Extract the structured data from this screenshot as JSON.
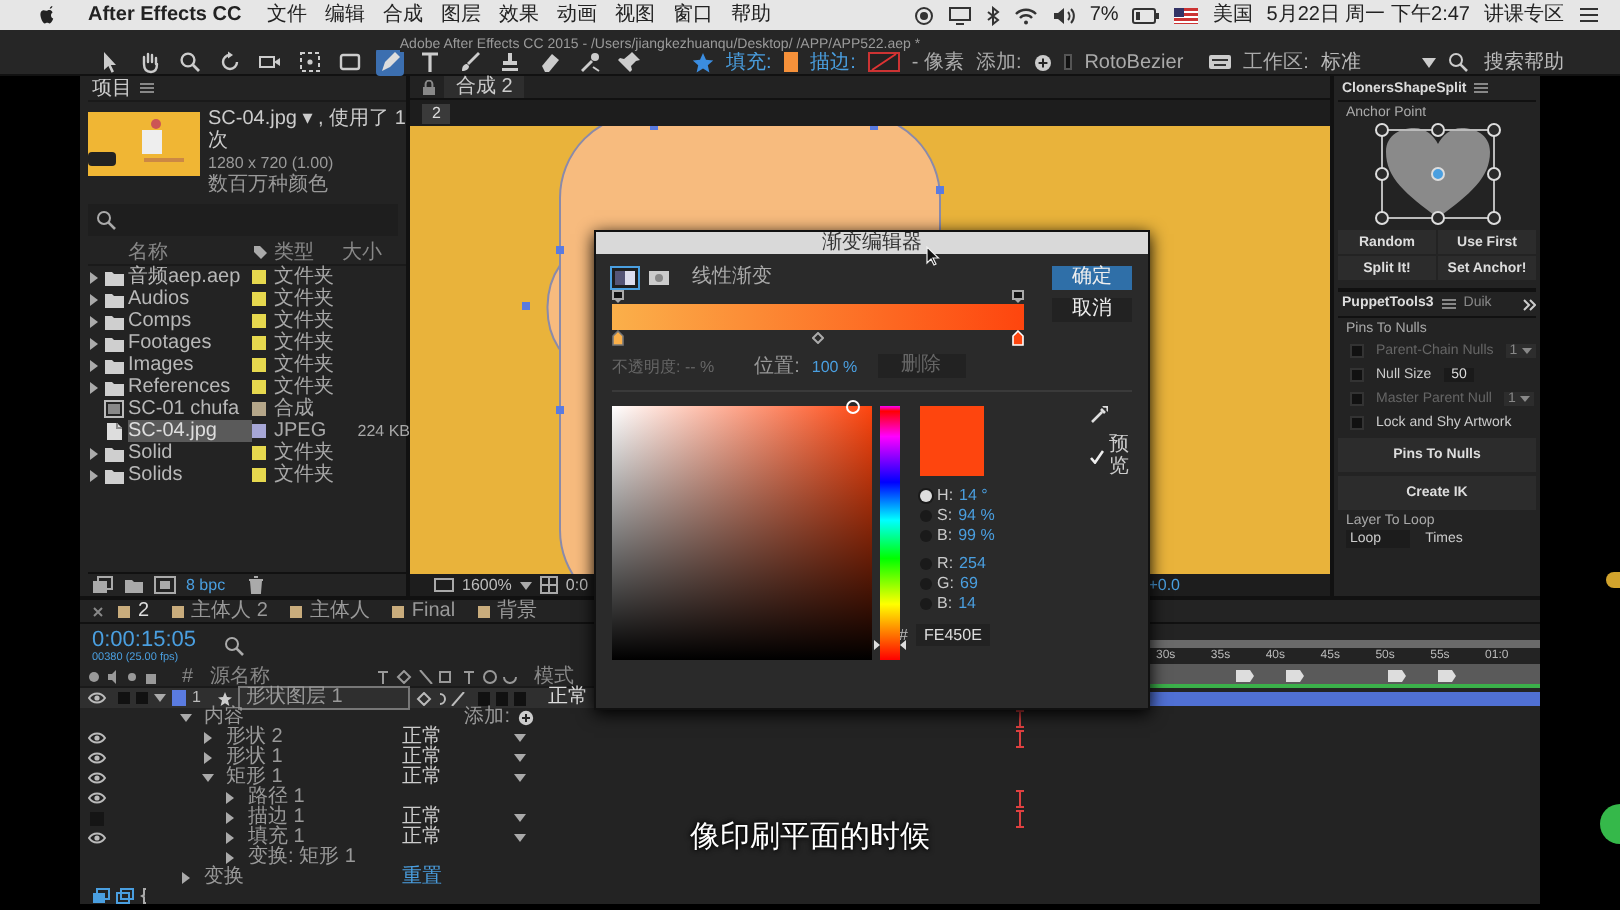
{
  "menubar": {
    "app": "After Effects CC",
    "menus": [
      "文件",
      "编辑",
      "合成",
      "图层",
      "效果",
      "动画",
      "视图",
      "窗口",
      "帮助"
    ],
    "battery": "7%",
    "input_source": "美国",
    "clock": "5月22日 周一 下午2:47",
    "user": "讲课专区"
  },
  "window": {
    "title": "Adobe After Effects CC 2015 - /Users/jiangkezhuanqu/Desktop/ /APP/APP522.aep *"
  },
  "toolbar": {
    "tools": [
      {
        "kind": "selection",
        "selected": false
      },
      {
        "kind": "hand",
        "selected": false
      },
      {
        "kind": "zoom",
        "selected": false
      },
      {
        "kind": "rotate",
        "selected": false
      },
      {
        "kind": "camera",
        "selected": false
      },
      {
        "kind": "pan",
        "selected": false
      },
      {
        "kind": "rectangle",
        "selected": false
      },
      {
        "kind": "pen",
        "selected": true
      },
      {
        "kind": "text",
        "selected": false
      },
      {
        "kind": "brush",
        "selected": false
      },
      {
        "kind": "stamp",
        "selected": false
      },
      {
        "kind": "eraser",
        "selected": false
      },
      {
        "kind": "roto",
        "selected": false
      },
      {
        "kind": "pin",
        "selected": false
      }
    ],
    "fill_label": "填充:",
    "stroke_label": "描边:",
    "stroke_width": "- 像素",
    "add_label": "添加:",
    "rotobezier": {
      "label": "RotoBezier",
      "checked": false
    },
    "workspace_label": "工作区:",
    "workspace": "标准",
    "search_placeholder": "搜索帮助"
  },
  "project": {
    "title": "项目",
    "file_name": "SC-04.jpg ▾ , 使用了 1 次",
    "dimensions": "1280 x 720 (1.00)",
    "color_depth": "数百万种颜色",
    "columns": [
      "名称",
      "类型",
      "大小"
    ],
    "rows": [
      {
        "name": "音频aep.aep",
        "kind": "folder",
        "expanded": false,
        "type": "文件夹",
        "color": "#e6d84e",
        "selected": false
      },
      {
        "name": "Audios",
        "kind": "folder",
        "expanded": false,
        "type": "文件夹",
        "color": "#e6d84e",
        "selected": false
      },
      {
        "name": "Comps",
        "kind": "folder",
        "expanded": false,
        "type": "文件夹",
        "color": "#e6d84e",
        "selected": false
      },
      {
        "name": "Footages",
        "kind": "folder",
        "expanded": false,
        "type": "文件夹",
        "color": "#e6d84e",
        "selected": false
      },
      {
        "name": "Images",
        "kind": "folder",
        "expanded": false,
        "type": "文件夹",
        "color": "#e6d84e",
        "selected": false
      },
      {
        "name": "References",
        "kind": "folder",
        "expanded": false,
        "type": "文件夹",
        "color": "#e6d84e",
        "selected": false
      },
      {
        "name": "SC-01 chufa",
        "kind": "comp",
        "type": "合成",
        "color": "#b5a689",
        "selected": false
      },
      {
        "name": "SC-04.jpg",
        "kind": "image",
        "type": "JPEG",
        "size": "224 KB",
        "color": "#a6a6d6",
        "selected": true
      },
      {
        "name": "Solid",
        "kind": "folder",
        "expanded": false,
        "type": "文件夹",
        "color": "#e6d84e",
        "selected": false
      },
      {
        "name": "Solids",
        "kind": "folder",
        "expanded": false,
        "type": "文件夹",
        "color": "#e6d84e",
        "selected": false
      }
    ],
    "bpc": "8 bpc"
  },
  "viewer": {
    "tab": "合成 2",
    "breadcrumb": "2",
    "zoom": "1600%",
    "timecode": "0:0",
    "exposure": "+0.0"
  },
  "cloners": {
    "title": "ClonersShapeSplit",
    "anchor_label": "Anchor Point",
    "anchor_points": [
      {
        "selected": false
      },
      {
        "selected": false
      },
      {
        "selected": false
      },
      {
        "selected": false
      },
      {
        "selected": true
      },
      {
        "selected": false
      },
      {
        "selected": false
      },
      {
        "selected": false
      },
      {
        "selected": false
      }
    ],
    "buttons": [
      "Random",
      "Use First",
      "Split It!",
      "Set Anchor!"
    ]
  },
  "puppet": {
    "tabs": [
      {
        "label": "PuppetTools3",
        "selected": true
      },
      {
        "label": "Duik",
        "selected": false
      }
    ],
    "section": "Pins To Nulls",
    "options": [
      {
        "label": "Parent-Chain Nulls",
        "kind": "dropdown",
        "checked": false,
        "disabled": true,
        "value": "1"
      },
      {
        "label": "Null Size",
        "kind": "number",
        "checked": false,
        "disabled": false,
        "value": "50"
      },
      {
        "label": "Master Parent Null",
        "kind": "dropdown",
        "checked": false,
        "disabled": true,
        "value": "1"
      },
      {
        "label": "Lock and Shy Artwork",
        "kind": "plain",
        "checked": false,
        "disabled": false
      }
    ],
    "buttons": [
      "Pins To Nulls",
      "Create IK"
    ],
    "loop_label": "Layer To Loop",
    "loop_mode": "Loop",
    "times_label": "Times"
  },
  "timeline": {
    "tabs": [
      {
        "label": "2",
        "selected": true
      },
      {
        "label": "主体人 2",
        "selected": false
      },
      {
        "label": "主体人",
        "selected": false
      },
      {
        "label": "Final",
        "selected": false
      },
      {
        "label": "背景",
        "selected": false
      }
    ],
    "timecode": "0:00:15:05",
    "frame_info": "00380 (25.00 fps)",
    "columns": {
      "number": "#",
      "source_name": "源名称",
      "mode": "模式"
    },
    "layer": {
      "number": "1",
      "name": "形状图层 1",
      "mode": "正常",
      "selected": true,
      "visible": true
    },
    "outline": [
      {
        "label": "内容",
        "expanded": true,
        "action": "添加:",
        "keyframe": true,
        "children": [
          {
            "label": "形状 2",
            "expanded": false,
            "mode": "正常",
            "visible": true,
            "keyframe": true
          },
          {
            "label": "形状 1",
            "expanded": false,
            "mode": "正常",
            "visible": true,
            "keyframe": false
          },
          {
            "label": "矩形 1",
            "expanded": true,
            "mode": "正常",
            "visible": true,
            "keyframe": false,
            "children": [
              {
                "label": "路径 1",
                "expanded": false,
                "visible": true,
                "keyframe": true
              },
              {
                "label": "描边 1",
                "expanded": false,
                "mode": "正常",
                "visible": false,
                "keyframe": true
              },
              {
                "label": "填充 1",
                "expanded": false,
                "mode": "正常",
                "visible": true,
                "keyframe": false
              },
              {
                "label": "变换: 矩形 1",
                "expanded": false,
                "keyframe": false
              }
            ]
          }
        ]
      },
      {
        "label": "变换",
        "expanded": false,
        "reset": "重置",
        "keyframe": false
      }
    ],
    "ruler": [
      "30s",
      "35s",
      "40s",
      "45s",
      "50s",
      "55s",
      "01:0"
    ]
  },
  "dialog": {
    "title": "渐变编辑器",
    "gradient_types": [
      {
        "selected": true
      },
      {
        "selected": false
      }
    ],
    "type_label": "线性渐变",
    "ok": "确定",
    "cancel": "取消",
    "opacity_stops": [
      {
        "selected": false
      },
      {
        "selected": false
      }
    ],
    "color_stops": [
      {
        "color": "#fbb04a",
        "selected": false
      },
      {
        "color": "#fe450e",
        "selected": true
      }
    ],
    "opacity": "不透明度: -- %",
    "location_label": "位置:",
    "location_value": "100 %",
    "delete": "删除",
    "preview": {
      "label": "预览",
      "checked": true
    },
    "channels": [
      {
        "label": "H:",
        "value": "14 °",
        "selected": true
      },
      {
        "label": "S:",
        "value": "94 %",
        "selected": false
      },
      {
        "label": "B:",
        "value": "99 %",
        "selected": false
      },
      {
        "label": "R:",
        "value": "254",
        "selected": false
      },
      {
        "label": "G:",
        "value": "69",
        "selected": false
      },
      {
        "label": "B:",
        "value": "14",
        "selected": false
      }
    ],
    "hue": {
      "level": 0.04
    },
    "hex_label": "#",
    "hex": "FE450E"
  },
  "subtitle": "像印刷平面的时候"
}
